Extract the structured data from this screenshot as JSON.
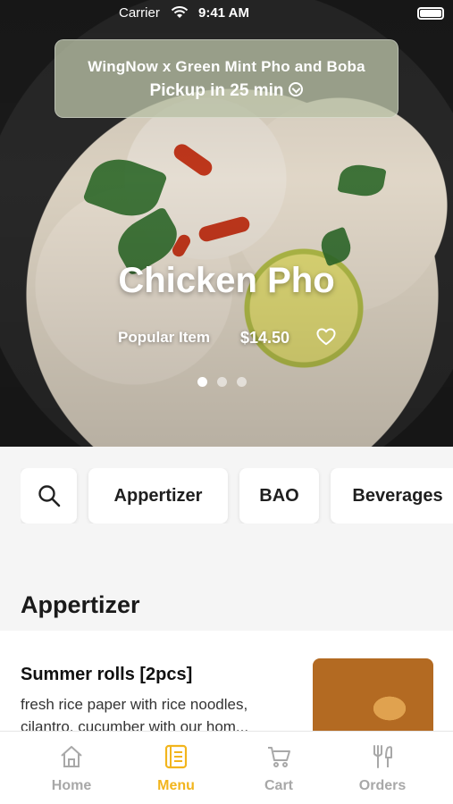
{
  "status_bar": {
    "carrier": "Carrier",
    "time": "9:41 AM"
  },
  "banner": {
    "title": "WingNow x Green Mint Pho and Boba",
    "pickup": "Pickup in 25 min"
  },
  "hero": {
    "item_name": "Chicken Pho",
    "tag": "Popular Item",
    "price": "$14.50",
    "carousel": {
      "count": 3,
      "active_index": 0
    }
  },
  "categories": [
    "Appertizer",
    "BAO",
    "Beverages"
  ],
  "section": {
    "title": "Appertizer"
  },
  "menu_items": [
    {
      "name": "Summer rolls [2pcs]",
      "description": "fresh rice paper with rice noodles, cilantro, cucumber with our hom..."
    }
  ],
  "tabbar": {
    "tabs": [
      {
        "label": "Home",
        "icon": "home-icon"
      },
      {
        "label": "Menu",
        "icon": "menu-icon"
      },
      {
        "label": "Cart",
        "icon": "cart-icon"
      },
      {
        "label": "Orders",
        "icon": "orders-icon"
      }
    ],
    "active": "Menu"
  },
  "colors": {
    "accent": "#f2b51d",
    "inactive_tab": "#a8a8a8",
    "background": "#f5f5f5"
  }
}
